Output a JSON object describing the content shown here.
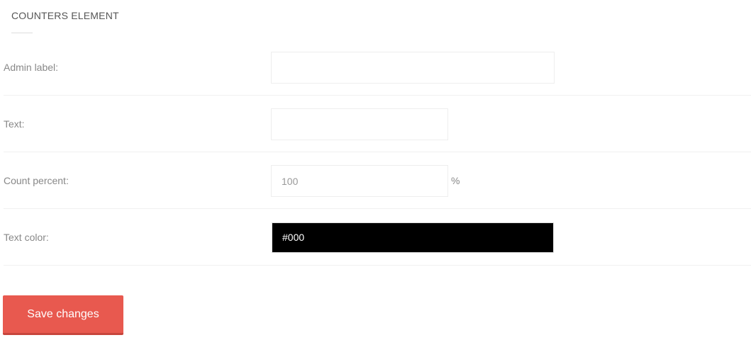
{
  "panel": {
    "title": "COUNTERS ELEMENT"
  },
  "form": {
    "admin_label": {
      "label": "Admin label:",
      "value": ""
    },
    "text": {
      "label": "Text:",
      "value": ""
    },
    "count_percent": {
      "label": "Count percent:",
      "value": "100",
      "unit": "%"
    },
    "text_color": {
      "label": "Text color:",
      "value": "#000"
    }
  },
  "actions": {
    "save_label": "Save changes"
  },
  "colors": {
    "accent": "#e8594f",
    "swatch": "#000000"
  }
}
